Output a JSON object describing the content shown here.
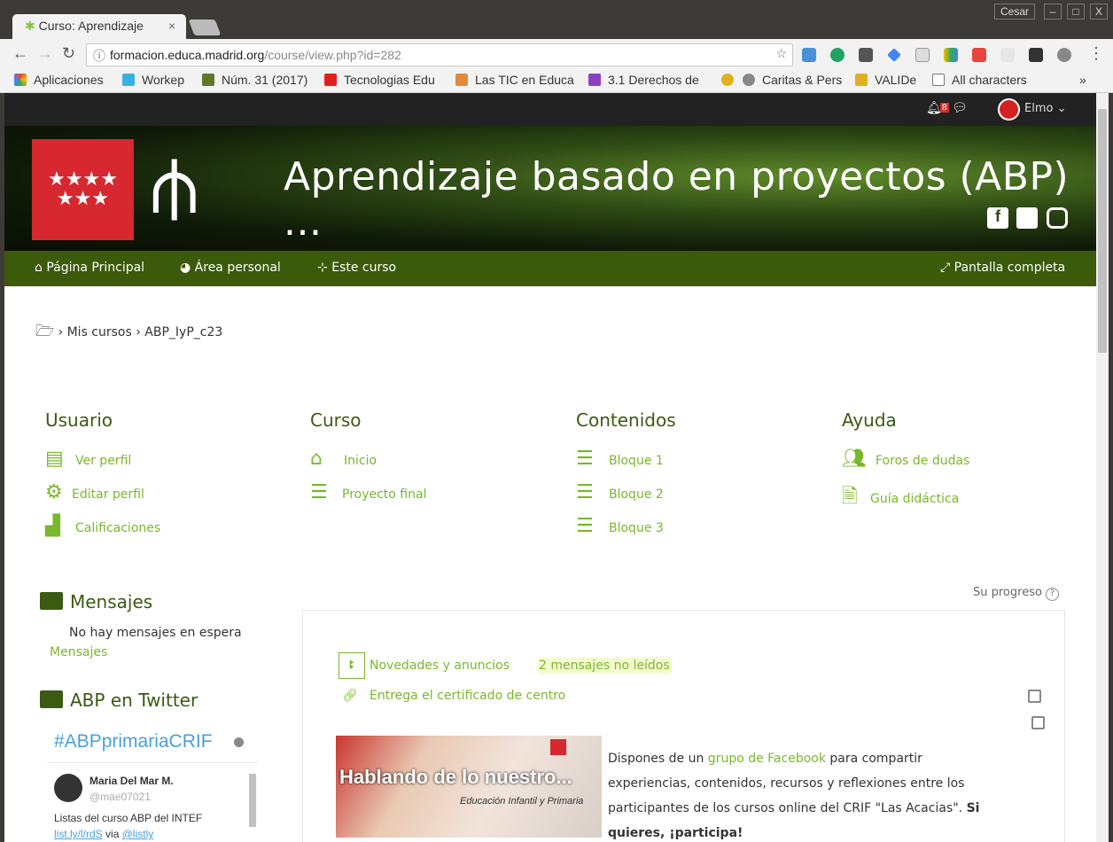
{
  "browser": {
    "tab_title": "Curso: Aprendizaje",
    "user": "Cesar",
    "window_controls": [
      "–",
      "□",
      "X"
    ],
    "url_host": "formacion.educa.madrid.org",
    "url_path": "/course/view.php?id=282",
    "bookmarks": [
      {
        "label": "Aplicaciones",
        "color": "#e04a3a"
      },
      {
        "label": "Workep",
        "color": "#3ab0e0"
      },
      {
        "label": "Núm. 31 (2017)",
        "color": "#5a7a2a"
      },
      {
        "label": "Tecnologias Edu",
        "color": "#e02020"
      },
      {
        "label": "Las TIC en Educa",
        "color": "#e08a40"
      },
      {
        "label": "3.1 Derechos de",
        "color": "#8a40c0"
      },
      {
        "label": "",
        "color": "#e0b020"
      },
      {
        "label": "Caritas & Pers",
        "color": "#888888"
      },
      {
        "label": "VALIDe",
        "color": "#e0b020"
      },
      {
        "label": "All characters",
        "color": "#dddddd"
      }
    ],
    "more": "»"
  },
  "topbar": {
    "notifications": "8",
    "user": "Elmo"
  },
  "header": {
    "title": "Aprendizaje basado en proyectos (ABP) ..."
  },
  "nav": {
    "home": "Página Principal",
    "personal": "Área personal",
    "course": "Este curso",
    "fullscreen": "Pantalla completa"
  },
  "breadcrumb": [
    "Mis cursos",
    "ABP_IyP_c23"
  ],
  "columns": [
    {
      "title": "Usuario",
      "items": [
        {
          "label": "Ver perfil",
          "icon": "id-card-icon"
        },
        {
          "label": "Editar perfil",
          "icon": "gear-icon"
        },
        {
          "label": "Calificaciones",
          "icon": "bar-chart-icon"
        }
      ]
    },
    {
      "title": "Curso",
      "items": [
        {
          "label": "Inicio",
          "icon": "home-icon"
        },
        {
          "label": "Proyecto final",
          "icon": "server-icon"
        }
      ]
    },
    {
      "title": "Contenidos",
      "items": [
        {
          "label": "Bloque 1",
          "icon": "list-ol-icon"
        },
        {
          "label": "Bloque 2",
          "icon": "list-ol-icon"
        },
        {
          "label": "Bloque 3",
          "icon": "list-ol-icon"
        }
      ]
    },
    {
      "title": "Ayuda",
      "items": [
        {
          "label": "Foros de dudas",
          "icon": "users-icon"
        },
        {
          "label": "Guía didáctica",
          "icon": "document-icon"
        }
      ]
    }
  ],
  "messages": {
    "title": "Mensajes",
    "empty": "No hay mensajes en espera",
    "link": "Mensajes"
  },
  "twitter": {
    "title": "ABP en Twitter",
    "hashtag": "#ABPprimariaCRIF",
    "tweet": {
      "name": "Maria Del Mar M.",
      "handle": "@mae07021",
      "text": "Listas del curso ABP del INTEF",
      "link": "list.ly/l/rdS",
      "via": "via",
      "via_user": "@listly"
    }
  },
  "progress": {
    "label": "Su progreso"
  },
  "activities": [
    {
      "label": "Novedades y anuncios",
      "badge": "2 mensajes no leídos"
    },
    {
      "label": "Entrega el certificado de centro"
    }
  ],
  "facebook": {
    "image_text": "Hablando de lo nuestro...",
    "image_sub": "Educación Infantil y Primaria",
    "pre": "Dispones de un ",
    "link": "grupo de Facebook",
    "post": " para compartir experiencias, contenidos, recursos y reflexiones entre los participantes de los cursos online del CRIF \"Las Acacias\". ",
    "bold": "Si quieres, ¡participa!"
  },
  "colors": {
    "accent": "#7ab72b",
    "nav_bg": "#3b5a0a",
    "heading": "#3b5a12",
    "logo_red": "#d7282f"
  }
}
